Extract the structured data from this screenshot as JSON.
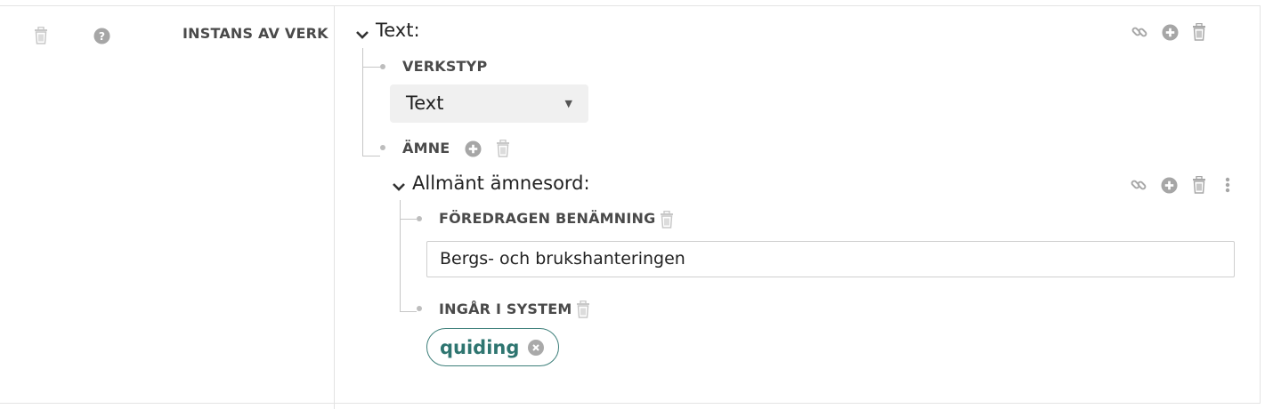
{
  "row": {
    "label": "INSTANS AV VERK"
  },
  "work": {
    "title": "Text:",
    "fields": {
      "verkstyp": {
        "label": "VERKSTYP",
        "select_value": "Text"
      },
      "amne": {
        "label": "ÄMNE"
      }
    },
    "subject": {
      "title": "Allmänt ämnesord:",
      "fields": {
        "foredragen": {
          "label": "FÖREDRAGEN BENÄMNING",
          "value": "Bergs- och brukshanteringen"
        },
        "ingar": {
          "label": "INGÅR I SYSTEM",
          "chip": "quiding"
        }
      }
    }
  },
  "icons": {
    "row_delete": "trash-icon",
    "row_help": "question-circle-icon",
    "link": "link-icon",
    "add": "plus-circle-icon",
    "delete": "trash-icon",
    "more": "vertical-dots-icon",
    "expand": "chevron-down-icon",
    "chip_remove": "close-circle-icon"
  },
  "colors": {
    "chip_text": "#2e7570",
    "chip_border": "#3d7f7a",
    "icon_gray": "#a0a0a0",
    "icon_light": "#c8c8c8"
  }
}
